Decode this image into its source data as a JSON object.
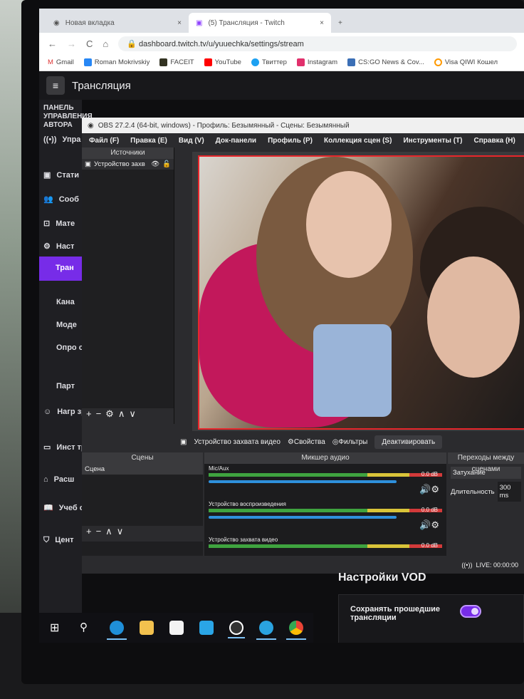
{
  "browser": {
    "tabs": [
      {
        "label": "Новая вкладка"
      },
      {
        "label": "(5) Трансляция - Twitch"
      }
    ],
    "url": "dashboard.twitch.tv/u/yuuechka/settings/stream",
    "bookmarks": [
      "Gmail",
      "Roman Mokrivskiy",
      "FACEIT",
      "YouTube",
      "Твиттер",
      "Instagram",
      "CS:GO News & Cov...",
      "Visa QIWI Кошел"
    ]
  },
  "twitch": {
    "page_title": "Трансляция",
    "sidebar_heading": "ПАНЕЛЬ УПРАВЛЕНИЯ АВТОРА",
    "sidebar": [
      "Упра трані",
      "Стати",
      "Сооб",
      "Мате",
      "Наст",
      "Тран",
      "Кана",
      "Моде",
      "Опро стри",
      "Парт",
      "Нагр зрите",
      "Инст трані",
      "Расш",
      "Учеб стри",
      "Цент"
    ],
    "vod_title": "Настройки VOD",
    "vod_option": "Сохранять прошедшие трансляции",
    "vod_toggle_on": true,
    "accent": "#772ce8"
  },
  "obs": {
    "title": "OBS 27.2.4 (64-bit, windows) - Профиль: Безымянный - Сцены: Безымянный",
    "menu": [
      "Файл (F)",
      "Правка (E)",
      "Вид (V)",
      "Док-панели",
      "Профиль (P)",
      "Коллекция сцен (S)",
      "Инструменты (T)",
      "Справка (H)"
    ],
    "sources_title": "Источники",
    "source_item": "Устройство захв",
    "selected_source": "Устройство захвата видео",
    "properties": "Свойства",
    "filters": "Фильтры",
    "deactivate": "Деактивировать",
    "scenes_title": "Сцены",
    "scene_item": "Сцена",
    "mixer_title": "Микшер аудио",
    "channels": [
      {
        "name": "Mic/Aux",
        "db": "0.0 dB"
      },
      {
        "name": "Устройство воспроизведения",
        "db": "0.0 dB"
      },
      {
        "name": "Устройство захвата видео",
        "db": "0.0 dB"
      }
    ],
    "transitions_title": "Переходы между сценами",
    "transition": "Затухание",
    "duration_label": "Длительность",
    "duration": "300 ms",
    "live": "LIVE: 00:00:00"
  }
}
